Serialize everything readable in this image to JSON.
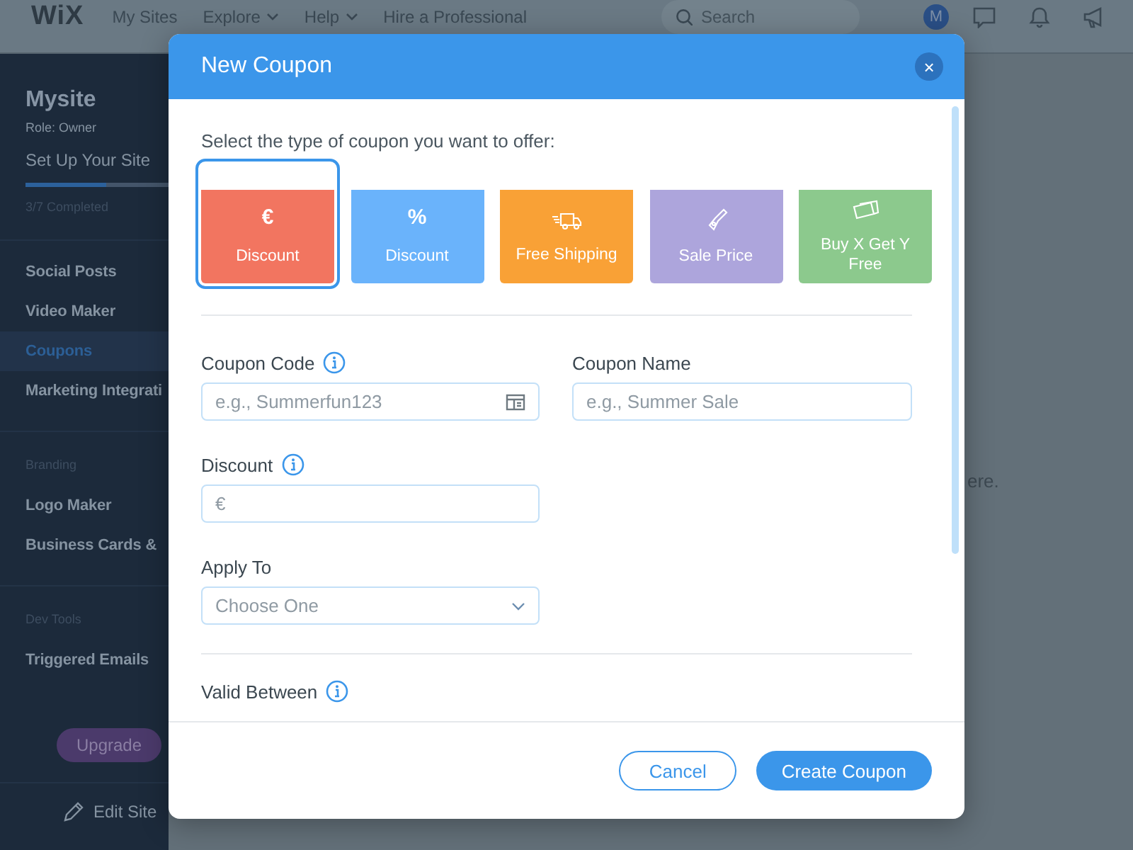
{
  "top_bar": {
    "logo": "WiX",
    "nav": [
      {
        "label": "My Sites",
        "dropdown": false
      },
      {
        "label": "Explore",
        "dropdown": true
      },
      {
        "label": "Help",
        "dropdown": true
      },
      {
        "label": "Hire a Professional",
        "dropdown": false
      }
    ],
    "search": {
      "placeholder": "Search"
    },
    "avatar": "M"
  },
  "sidebar": {
    "site_name": "Mysite",
    "role": "Role: Owner",
    "setup": {
      "title": "Set Up Your Site",
      "level": 0.56,
      "status": "3/7 Completed"
    },
    "sections": [
      {
        "items": [
          {
            "label": "Social Posts",
            "selected": false
          },
          {
            "label": "Video Maker",
            "selected": false
          },
          {
            "label": "Coupons",
            "selected": true
          },
          {
            "label": "Marketing Integrati",
            "selected": false
          }
        ]
      },
      {
        "heading": "Branding",
        "items": [
          {
            "label": "Logo Maker",
            "selected": false
          },
          {
            "label": "Business Cards &",
            "selected": false
          }
        ]
      },
      {
        "heading": "Dev Tools",
        "items": [
          {
            "label": "Triggered Emails",
            "selected": false
          }
        ]
      }
    ],
    "upgrade_button": "Upgrade",
    "edit_site": "Edit Site"
  },
  "background_text": "ere.",
  "dialog": {
    "title": "New Coupon",
    "close": "×",
    "prompt": "Select the type of coupon you want to offer:",
    "coupon_types": [
      {
        "kind": "symbol",
        "symbol": "€",
        "label": "Discount",
        "color": "#f27560",
        "selected": true
      },
      {
        "kind": "symbol",
        "symbol": "%",
        "label": "Discount",
        "color": "#6ab3fb",
        "selected": false
      },
      {
        "kind": "truck",
        "label": "Free Shipping",
        "color": "#f9a136",
        "selected": false
      },
      {
        "kind": "tag",
        "label": "Sale Price",
        "color": "#ada5dc",
        "selected": false
      },
      {
        "kind": "cards",
        "label": "Buy X Get Y Free",
        "color": "#8cc98d",
        "selected": false
      }
    ],
    "coupon_code": {
      "label": "Coupon Code",
      "placeholder": "e.g., Summerfun123"
    },
    "coupon_name": {
      "label": "Coupon Name",
      "placeholder": "e.g., Summer Sale"
    },
    "discount": {
      "label": "Discount",
      "prefix": "€"
    },
    "apply_to": {
      "label": "Apply To",
      "placeholder": "Choose One"
    },
    "valid_between": {
      "label": "Valid Between"
    },
    "buttons": {
      "cancel": "Cancel",
      "create": "Create Coupon"
    }
  }
}
